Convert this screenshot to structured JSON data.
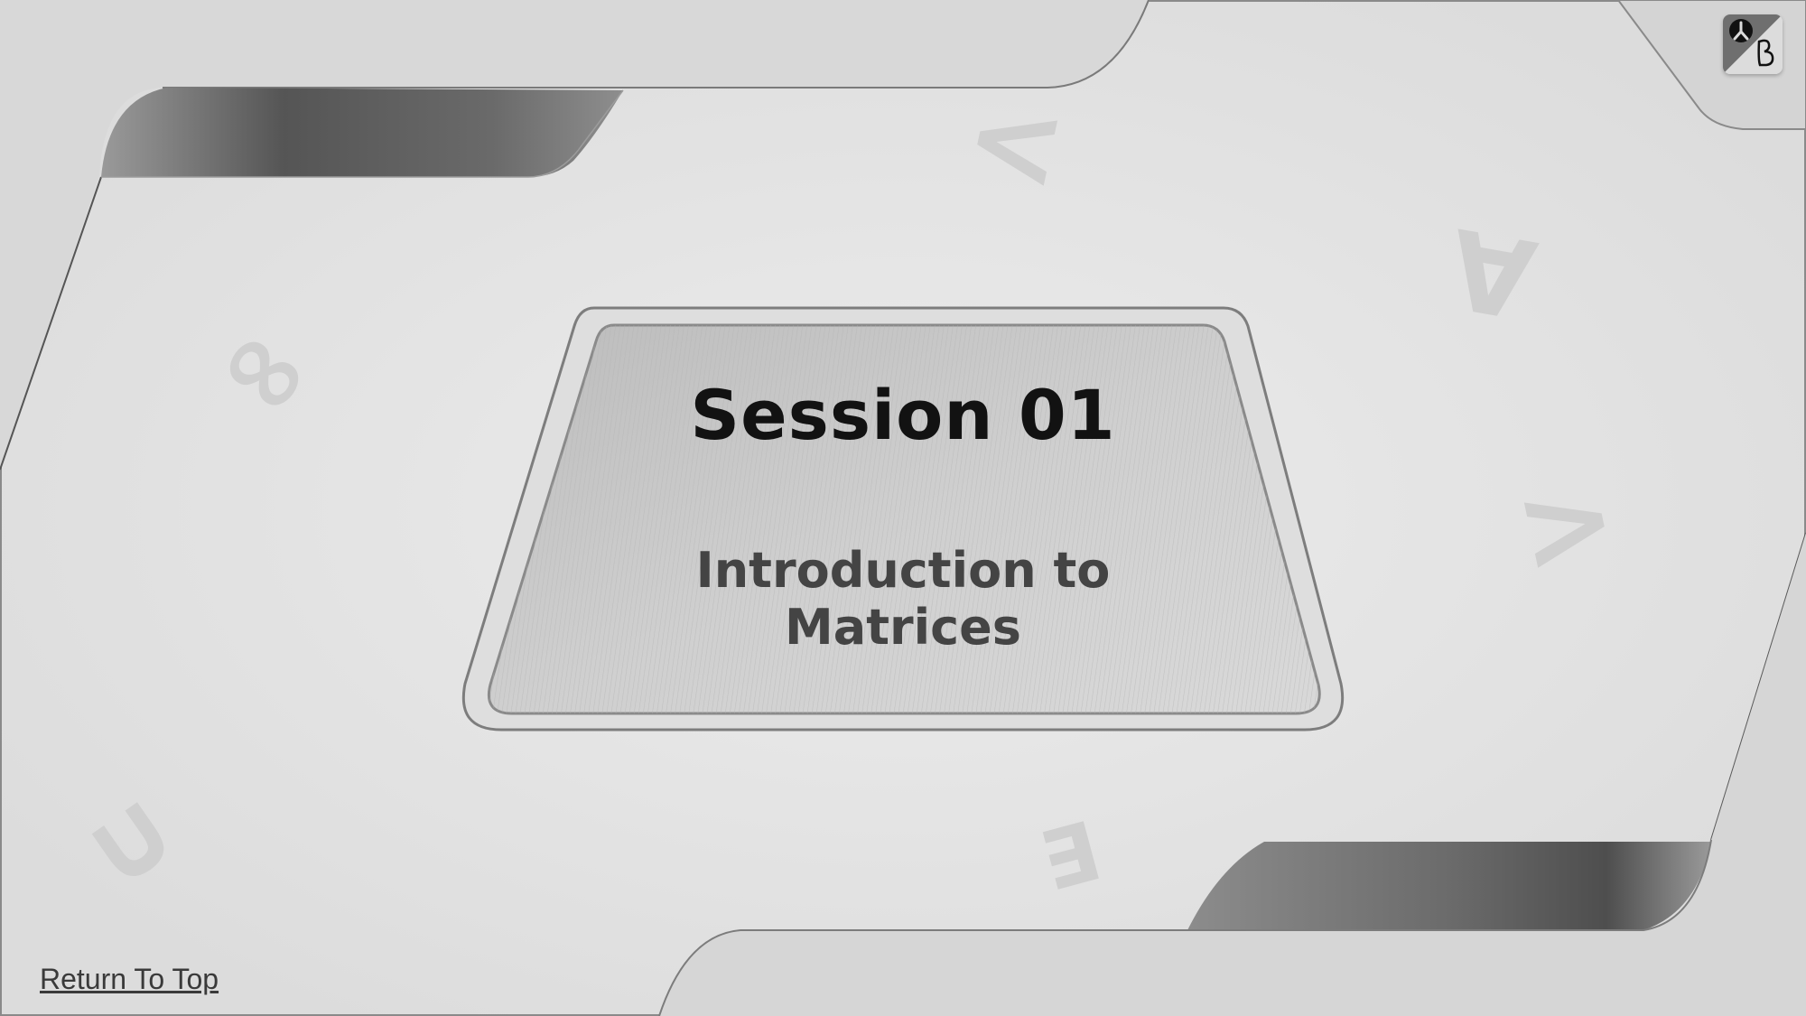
{
  "slide": {
    "title": "Session 01",
    "subtitle": "Introduction to Matrices"
  },
  "navigation": {
    "return_label": "Return To Top"
  },
  "decor": {
    "symbols": [
      "<",
      "∀",
      "∞",
      ">",
      "∪",
      "∃"
    ]
  },
  "brand": {
    "logo_icon": "publisher-logo-icon"
  },
  "colors": {
    "background": "#e4e4e4",
    "title": "#121212",
    "subtitle": "#444444",
    "dark_accent": "#5a5a5a"
  }
}
